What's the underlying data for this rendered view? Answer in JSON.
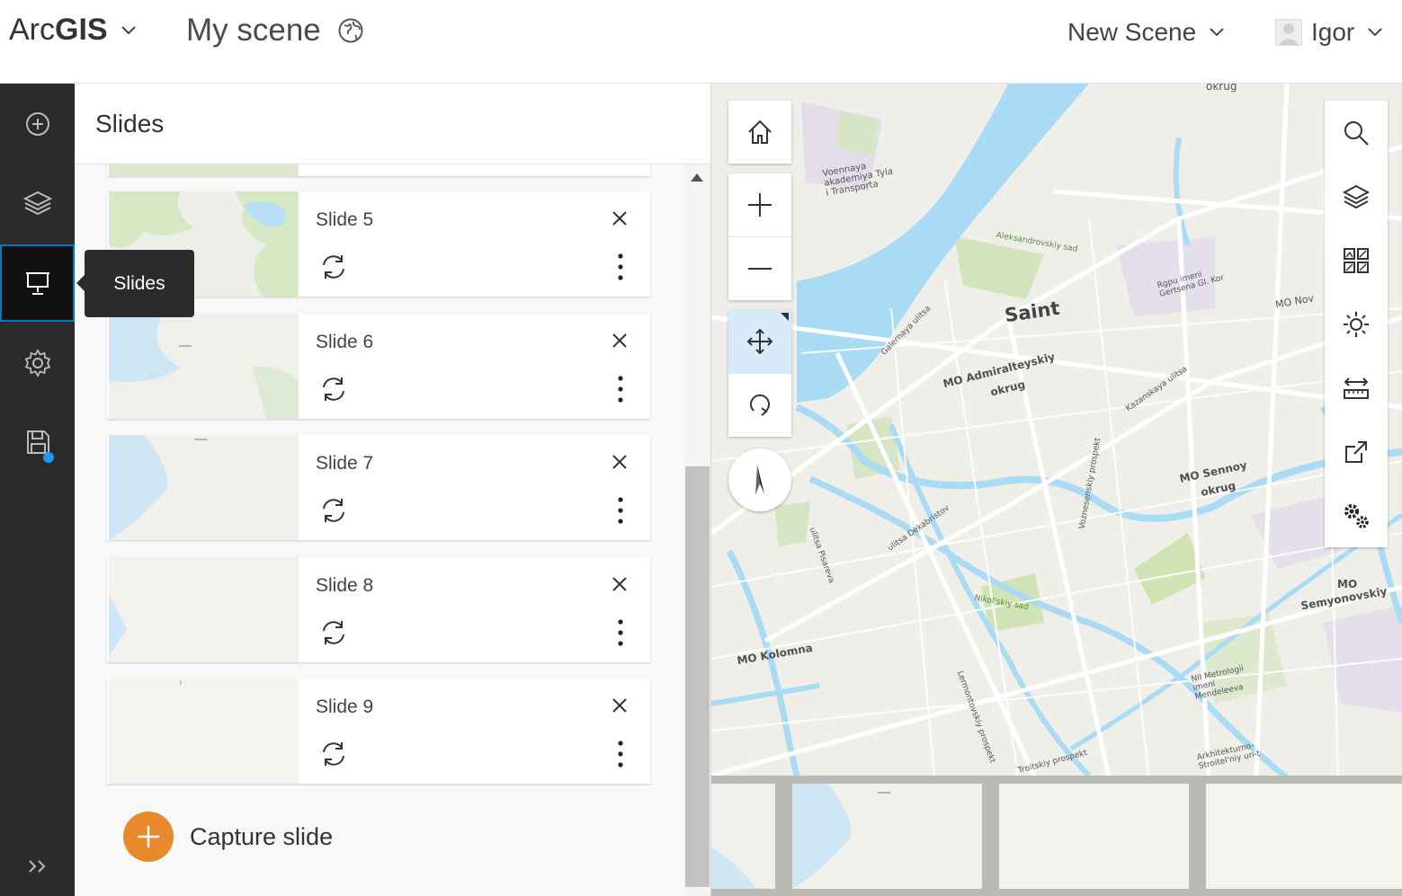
{
  "header": {
    "brand_light": "Arc",
    "brand_bold": "GIS",
    "scene_title": "My scene",
    "new_scene_label": "New Scene",
    "user_name": "Igor"
  },
  "sidebar": {
    "items": [
      {
        "icon": "add-icon"
      },
      {
        "icon": "layers-icon"
      },
      {
        "icon": "slides-icon",
        "active": true
      },
      {
        "icon": "gear-icon"
      },
      {
        "icon": "save-icon",
        "has_indicator": true
      }
    ],
    "expand_icon": "double-chevron-right-icon",
    "tooltip": "Slides",
    "indicator_color": "#2196f3"
  },
  "panel": {
    "title": "Slides",
    "slides": [
      {
        "name": "Slide 5"
      },
      {
        "name": "Slide 6"
      },
      {
        "name": "Slide 7"
      },
      {
        "name": "Slide 8"
      },
      {
        "name": "Slide 9"
      }
    ],
    "capture_label": "Capture slide",
    "capture_color": "#e8892b"
  },
  "map": {
    "labels": {
      "saint": "Saint",
      "admiralteysky": "MO Admiralteyskiy",
      "admiralteysky2": "okrug",
      "sennoy": "MO Sennoy",
      "sennoy2": "okrug",
      "kolomna": "MO Kolomna",
      "semyonovsky": "MO",
      "semyonovsky2": "Semyonovskiy",
      "okrug_top": "okrug",
      "mo_nov": "MO Nov",
      "aleksandrovsky": "Aleksandrovskiy sad",
      "nikolsky": "Nikol'skiy sad",
      "voennaya": "Voennaya akademiya Tyla i Transporta",
      "rgpu": "Rgpu imeni Gertsena Gl. Kor",
      "galernaya": "Galernaya ulitsa",
      "kazanskaya": "Kazanskaya ulitsa",
      "voznesensky": "Voznesenskiy prospekt",
      "dekabristov": "ulitsa Dekabristov",
      "pisareva": "ulitsa Pisareva",
      "lermontovsky": "Lermontovskiy prospekt",
      "troitsky": "Troitskiy prospekt",
      "niimetrologii": "NII Metrologii imeni Mendeleeva",
      "arkhitekturno": "Arkhitekturno-Stroitel'niy un-t"
    },
    "water_color": "#a9dbf5",
    "park_color": "#cfe3b4"
  }
}
